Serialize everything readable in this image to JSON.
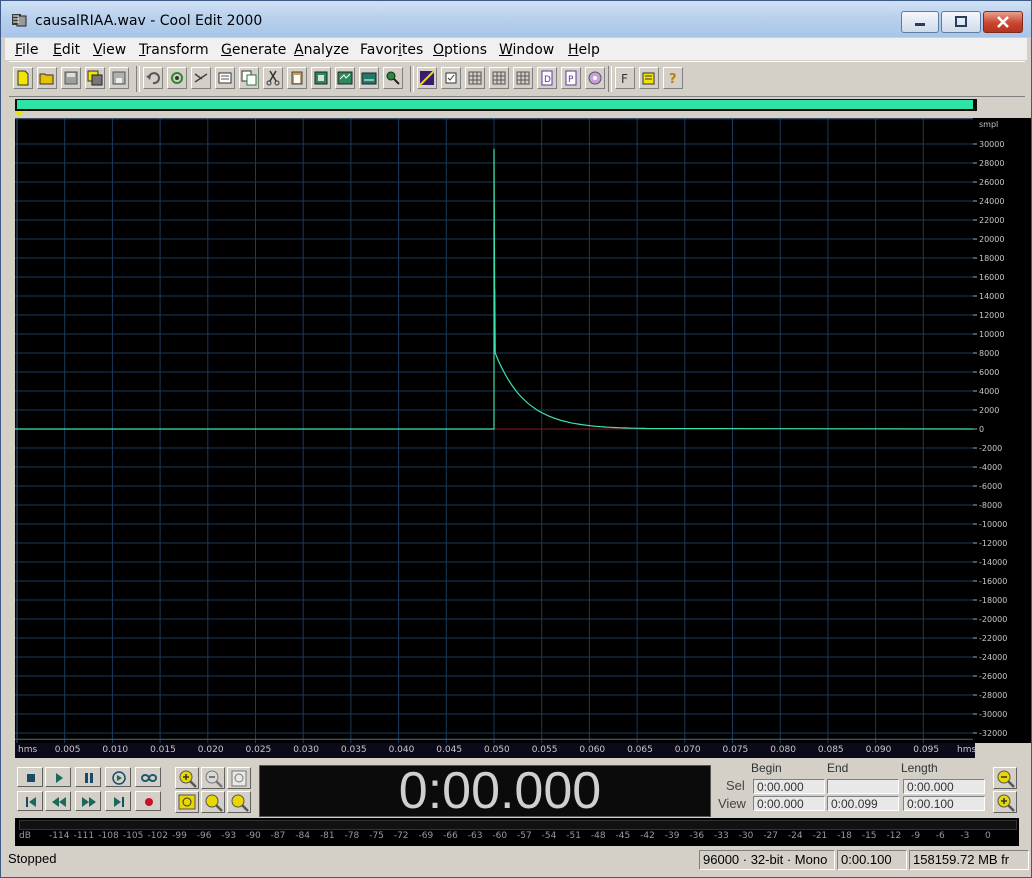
{
  "window": {
    "title": "causalRIAA.wav - Cool Edit 2000"
  },
  "menu": {
    "items": [
      {
        "pre": "",
        "u": "F",
        "post": "ile"
      },
      {
        "pre": "",
        "u": "E",
        "post": "dit"
      },
      {
        "pre": "",
        "u": "V",
        "post": "iew"
      },
      {
        "pre": "",
        "u": "T",
        "post": "ransform"
      },
      {
        "pre": "",
        "u": "G",
        "post": "enerate"
      },
      {
        "pre": "",
        "u": "A",
        "post": "nalyze"
      },
      {
        "pre": "Favor",
        "u": "i",
        "post": "tes"
      },
      {
        "pre": "",
        "u": "O",
        "post": "ptions"
      },
      {
        "pre": "",
        "u": "W",
        "post": "indow"
      },
      {
        "pre": "",
        "u": "H",
        "post": "elp"
      }
    ]
  },
  "waveform": {
    "amplitude_unit": "smpl",
    "amplitude_ticks": [
      "30000",
      "28000",
      "26000",
      "24000",
      "22000",
      "20000",
      "18000",
      "16000",
      "14000",
      "12000",
      "10000",
      "8000",
      "6000",
      "4000",
      "2000",
      "0",
      "-2000",
      "-4000",
      "-6000",
      "-8000",
      "-10000",
      "-12000",
      "-14000",
      "-16000",
      "-18000",
      "-20000",
      "-22000",
      "-24000",
      "-26000",
      "-28000",
      "-30000",
      "-32000"
    ],
    "amplitude_range": [
      -32768,
      32767
    ],
    "time_unit": "hms",
    "time_ticks": [
      "0.005",
      "0.010",
      "0.015",
      "0.020",
      "0.025",
      "0.030",
      "0.035",
      "0.040",
      "0.045",
      "0.050",
      "0.055",
      "0.060",
      "0.065",
      "0.070",
      "0.075",
      "0.080",
      "0.085",
      "0.090",
      "0.095"
    ],
    "time_range": [
      0,
      0.1
    ],
    "impulse_time": 0.05,
    "peak_value": 29500,
    "secondary_value": 14500,
    "decay_start_value": 8000,
    "decay_end_time": 0.066,
    "colors": {
      "background": "#000000",
      "grid": "#1c3a5a",
      "wave": "#3fe0b4",
      "centerline": "#8a1a1a"
    }
  },
  "display": {
    "time": "0:00.000"
  },
  "selection": {
    "headers": {
      "begin": "Begin",
      "end": "End",
      "length": "Length"
    },
    "sel_label": "Sel",
    "view_label": "View",
    "sel": {
      "begin": "0:00.000",
      "end": "",
      "length": "0:00.000"
    },
    "view": {
      "begin": "0:00.000",
      "end": "0:00.099",
      "length": "0:00.100"
    }
  },
  "meter": {
    "unit": "dB",
    "ticks": [
      "-114",
      "-111",
      "-108",
      "-105",
      "-102",
      "-99",
      "-96",
      "-93",
      "-90",
      "-87",
      "-84",
      "-81",
      "-78",
      "-75",
      "-72",
      "-69",
      "-66",
      "-63",
      "-60",
      "-57",
      "-54",
      "-51",
      "-48",
      "-45",
      "-42",
      "-39",
      "-36",
      "-33",
      "-30",
      "-27",
      "-24",
      "-21",
      "-18",
      "-15",
      "-12",
      "-9",
      "-6",
      "-3",
      "0"
    ]
  },
  "status": {
    "state": "Stopped",
    "format": "96000 · 32-bit · Mono",
    "length": "0:00.100",
    "free": "158159.72 MB fr"
  }
}
